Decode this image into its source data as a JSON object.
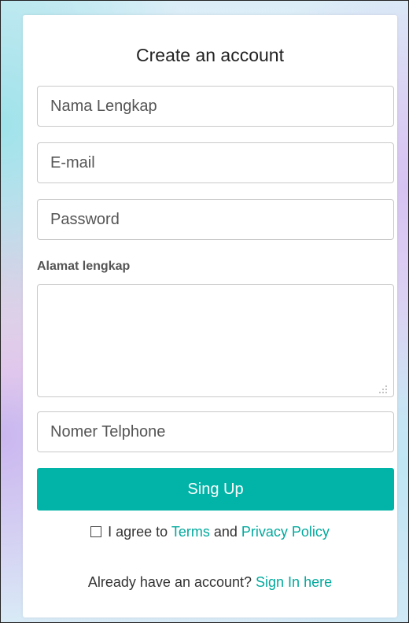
{
  "form": {
    "title": "Create an account",
    "full_name_placeholder": "Nama Lengkap",
    "email_placeholder": "E-mail",
    "password_placeholder": "Password",
    "address_label": "Alamat lengkap",
    "phone_placeholder": "Nomer Telphone",
    "submit_label": "Sing Up",
    "agree_prefix": " I agree to ",
    "terms_link": "Terms",
    "agree_and": " and ",
    "privacy_link": "Privacy Policy",
    "have_account_text": "Already have an account? ",
    "sign_in_link": "Sign In here"
  },
  "colors": {
    "accent": "#02b3a7",
    "link": "#02a99d"
  }
}
